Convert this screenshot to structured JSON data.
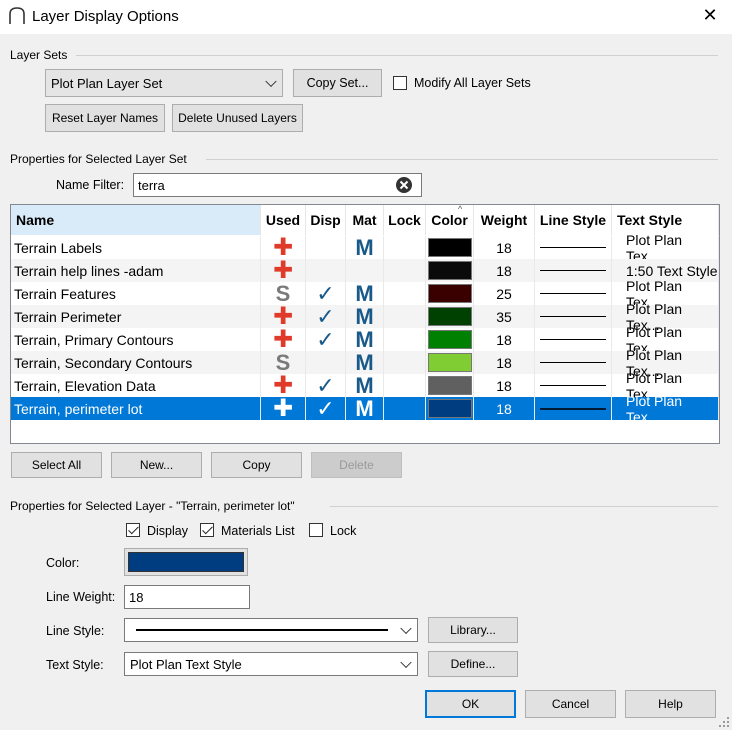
{
  "window": {
    "title": "Layer Display Options"
  },
  "layer_sets": {
    "group_label": "Layer Sets",
    "selected_set": "Plot Plan Layer Set",
    "copy_set_label": "Copy Set...",
    "modify_all_label": "Modify All Layer Sets",
    "modify_all_checked": false,
    "reset_names_label": "Reset Layer Names",
    "delete_unused_label": "Delete Unused Layers"
  },
  "set_props": {
    "group_label": "Properties for Selected Layer Set",
    "name_filter_label": "Name Filter:",
    "name_filter_value": "terra"
  },
  "table": {
    "columns": [
      "Name",
      "Used",
      "Disp",
      "Mat",
      "Lock",
      "Color",
      "Weight",
      "Line Style",
      "Text Style"
    ],
    "rows": [
      {
        "name": "Terrain Labels",
        "used": "+",
        "disp": "",
        "mat": "M",
        "lock": "",
        "color": "#000000",
        "weight": "18",
        "text_style": "Plot Plan Tex..."
      },
      {
        "name": "Terrain help lines -adam",
        "used": "+",
        "disp": "",
        "mat": "",
        "lock": "",
        "color": "#0a0a0a",
        "weight": "18",
        "text_style": "1:50 Text Style"
      },
      {
        "name": "Terrain Features",
        "used": "S",
        "disp": "✓",
        "mat": "M",
        "lock": "",
        "color": "#3a0000",
        "weight": "25",
        "text_style": "Plot Plan Tex..."
      },
      {
        "name": "Terrain Perimeter",
        "used": "+",
        "disp": "✓",
        "mat": "M",
        "lock": "",
        "color": "#004000",
        "weight": "35",
        "text_style": "Plot Plan Tex..."
      },
      {
        "name": "Terrain, Primary Contours",
        "used": "+",
        "disp": "✓",
        "mat": "M",
        "lock": "",
        "color": "#008000",
        "weight": "18",
        "text_style": "Plot Plan Tex..."
      },
      {
        "name": "Terrain, Secondary Contours",
        "used": "S",
        "disp": "",
        "mat": "M",
        "lock": "",
        "color": "#80cc33",
        "weight": "18",
        "text_style": "Plot Plan Tex..."
      },
      {
        "name": "Terrain, Elevation Data",
        "used": "+",
        "disp": "✓",
        "mat": "M",
        "lock": "",
        "color": "#606060",
        "weight": "18",
        "text_style": "Plot Plan Tex..."
      },
      {
        "name": "Terrain, perimeter lot",
        "used": "+",
        "disp": "✓",
        "mat": "M",
        "lock": "",
        "color": "#003d80",
        "weight": "18",
        "text_style": "Plot Plan Tex...",
        "selected": true
      }
    ]
  },
  "table_buttons": {
    "select_all": "Select All",
    "new": "New...",
    "copy": "Copy",
    "delete": "Delete"
  },
  "layer_props": {
    "group_label": "Properties for Selected Layer - \"Terrain, perimeter lot\"",
    "display_label": "Display",
    "display_checked": true,
    "materials_label": "Materials List",
    "materials_checked": true,
    "lock_label": "Lock",
    "lock_checked": false,
    "color_label": "Color:",
    "color_value": "#003d80",
    "line_weight_label": "Line Weight:",
    "line_weight_value": "18",
    "line_style_label": "Line Style:",
    "library_label": "Library...",
    "text_style_label": "Text Style:",
    "text_style_value": "Plot Plan Text Style",
    "define_label": "Define..."
  },
  "footer": {
    "ok": "OK",
    "cancel": "Cancel",
    "help": "Help"
  },
  "colors": {
    "accent": "#0078d7",
    "used_mark": "#e03b2a",
    "check_mark": "#1a5a8a"
  }
}
